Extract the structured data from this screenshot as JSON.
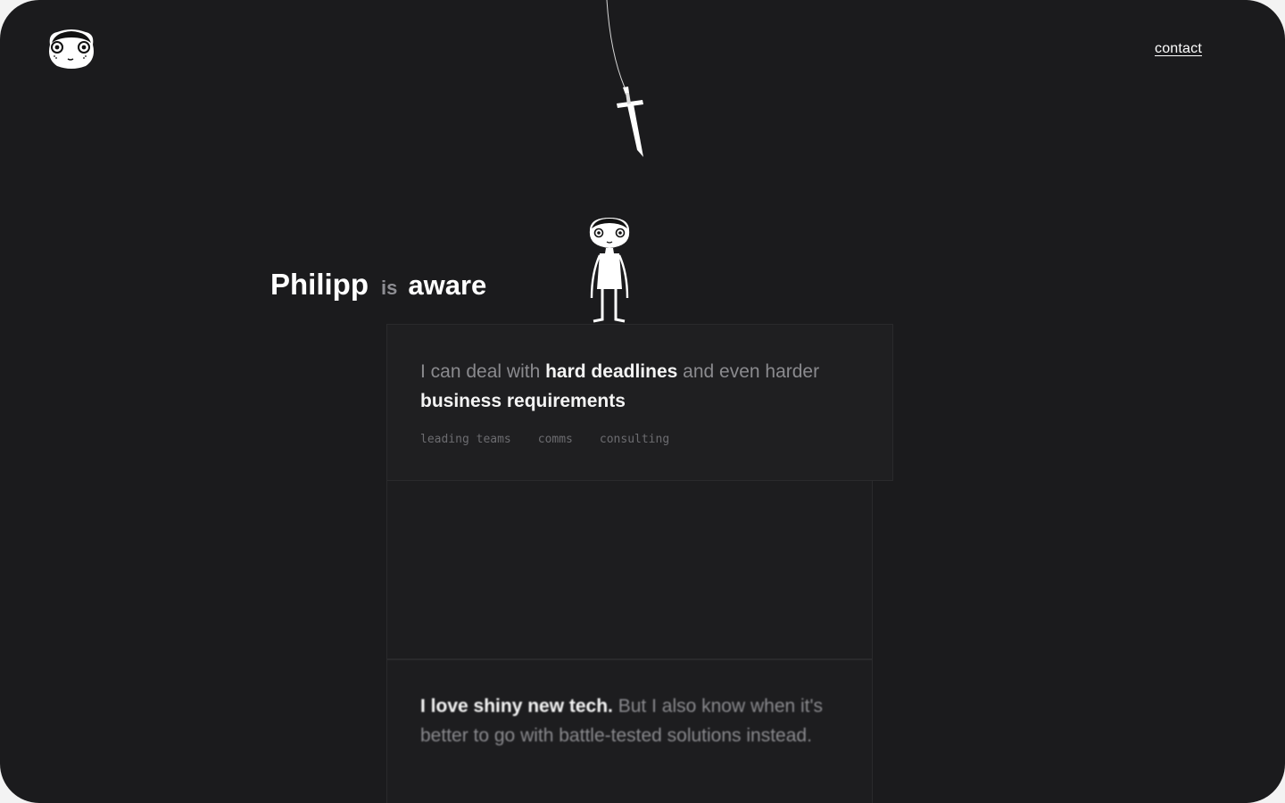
{
  "nav": {
    "contact_label": "contact"
  },
  "icons": {
    "logo": "cat-face-icon",
    "hanging_sword": "sword-icon",
    "character": "character-figure-icon"
  },
  "hero": {
    "name": "Philipp",
    "verb": "is",
    "adjective": "aware"
  },
  "cards": [
    {
      "segments": [
        {
          "text": "I can deal with ",
          "highlight": false
        },
        {
          "text": "hard deadlines",
          "highlight": true
        },
        {
          "text": " and even harder ",
          "highlight": false
        },
        {
          "text": "business requirements",
          "highlight": true
        }
      ],
      "tags": [
        "leading teams",
        "comms",
        "consulting"
      ]
    },
    {
      "segments": [],
      "tags": []
    },
    {
      "segments": [
        {
          "text": "I love shiny new tech.",
          "highlight": true
        },
        {
          "text": " But I also know when it's better to go with battle-tested solutions instead.",
          "highlight": false
        }
      ],
      "tags": [
        "",
        "",
        ""
      ]
    }
  ],
  "colors": {
    "background": "#1b1b1d",
    "card": "#1f1f21",
    "text_primary": "#ffffff",
    "text_muted": "#8a8a8e"
  }
}
